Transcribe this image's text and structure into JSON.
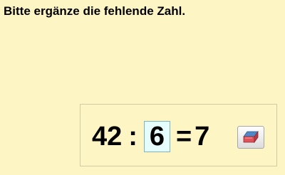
{
  "instruction": "Bitte ergänze die fehlende Zahl.",
  "equation": {
    "dividend": "42",
    "operator": ":",
    "answer": "6",
    "equals": "=",
    "result": "7"
  },
  "eraser": {
    "icon": "eraser-icon"
  },
  "colors": {
    "background": "#fef5c5",
    "answer_box_fill": "#e6fdfd",
    "answer_box_border": "#7db4c0",
    "eraser_blue": "#4f88c9",
    "eraser_red": "#e05259"
  }
}
